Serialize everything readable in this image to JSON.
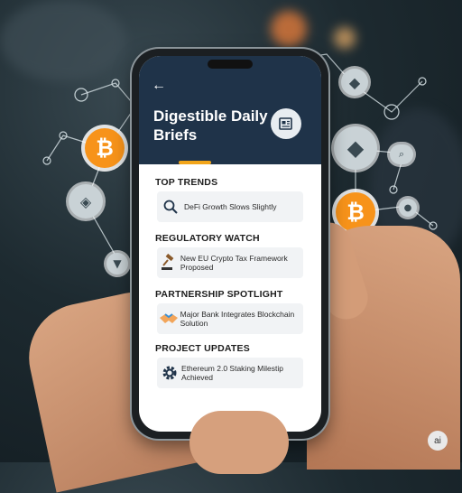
{
  "header": {
    "back_icon": "arrow-left-icon",
    "title": "Digestible Daily Briefs",
    "header_icon": "newspaper-icon"
  },
  "sections": [
    {
      "heading": "TOP TRENDS",
      "item_text": "DeFi Growth Slows Slightly",
      "icon": "magnifier-icon"
    },
    {
      "heading": "REGULATORY WATCH",
      "item_text": "New EU Crypto Tax Framework Proposed",
      "icon": "gavel-icon"
    },
    {
      "heading": "PARTNERSHIP SPOTLIGHT",
      "item_text": "Major Bank Integrates Blockchain Solution",
      "icon": "handshake-icon"
    },
    {
      "heading": "PROJECT UPDATES",
      "item_text": "Ethereum 2.0 Staking Milestip Achieved",
      "icon": "gear-icon"
    }
  ],
  "badge": {
    "text": "ai"
  },
  "colors": {
    "header_bg": "#1f3349",
    "accent": "#f2a51a",
    "bitcoin": "#f7931a"
  }
}
